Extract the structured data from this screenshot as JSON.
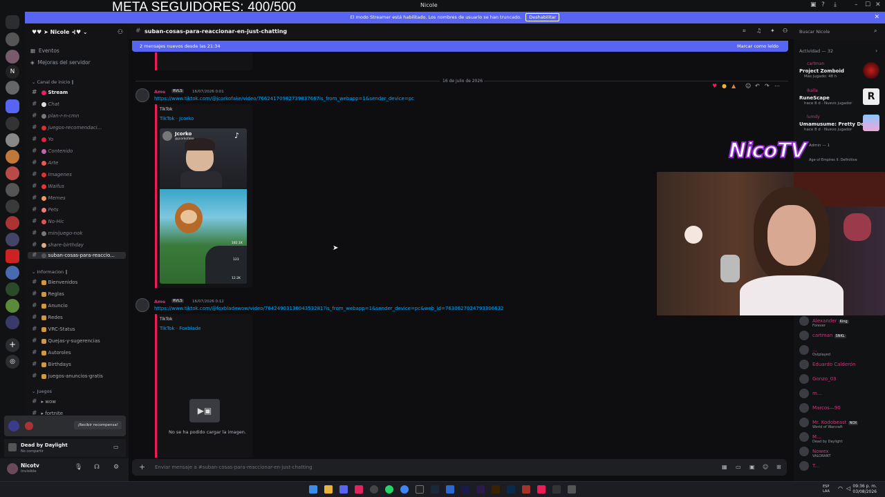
{
  "overlay": {
    "goal": "META SEGUIDORES: 400/500"
  },
  "window": {
    "title": "Nicole",
    "min": "–",
    "max": "☐",
    "close": "✕"
  },
  "banner": {
    "text": "El modo Streamer está habilitado. Los nombres de usuario se han truncado.",
    "button": "Deshabilitar"
  },
  "server": {
    "name": "Nicole",
    "items": [
      {
        "label": "Eventos"
      },
      {
        "label": "Mejoras del servidor"
      }
    ]
  },
  "categories": {
    "canal": "Canal de inicio ‖",
    "info": "Informacion ‖",
    "juegos": "Juegos"
  },
  "channels": [
    {
      "label": "Stream"
    },
    {
      "label": "Chat"
    },
    {
      "label": "plan-r-n-cmn"
    },
    {
      "label": "juegos-recomendaci..."
    },
    {
      "label": "Yo"
    },
    {
      "label": "Contenido"
    },
    {
      "label": "Arte"
    },
    {
      "label": "Imagenes"
    },
    {
      "label": "Waifus"
    },
    {
      "label": "Memes"
    },
    {
      "label": "Pets"
    },
    {
      "label": "No-Hic"
    },
    {
      "label": "minijuego-nok"
    },
    {
      "label": "share-birthday"
    },
    {
      "label": "suban-cosas-para-reaccio..."
    }
  ],
  "info_channels": [
    {
      "label": "Bienvenidos"
    },
    {
      "label": "Reglas"
    },
    {
      "label": "Anuncio"
    },
    {
      "label": "Redes"
    },
    {
      "label": "VRC-Status"
    },
    {
      "label": "Quejas-y-sugerencias"
    },
    {
      "label": "Autoroles"
    },
    {
      "label": "Birthdays"
    },
    {
      "label": "juegos-anuncios-gratis"
    }
  ],
  "game_channels": [
    {
      "label": "wow"
    },
    {
      "label": "fortnite"
    }
  ],
  "promo": {
    "button": "¡Recibir recompensa!"
  },
  "activity_game": {
    "title": "Dead by Daylight",
    "sub": "No compartir"
  },
  "user": {
    "name": "Nicotv",
    "status": "Invisible"
  },
  "header": {
    "channel": "suban-cosas-para-reaccionar-en-just-chatting",
    "search": "Buscar Nicole"
  },
  "newbar": {
    "text": "2 mensajes nuevos desde las 21:34",
    "mark": "Marcar como leído"
  },
  "date_divider": "16 de julio de 2026",
  "messages": [
    {
      "user": "Ame",
      "tag": "RVLS",
      "time": "16/07/2026 0:01",
      "link": "https://www.tiktok.com/@jcorkofake/video/76624170982739837667is_from_webapp=1&sender_device=pc",
      "provider": "TikTok",
      "title": "TikTok · Jcorko",
      "thumb_name": "Jcorko",
      "thumb_handle": "@jcorkofake",
      "likes": "182.1K",
      "comments": "123",
      "shares": "12.2K"
    },
    {
      "user": "Ame",
      "tag": "RVLS",
      "time": "16/07/2026 0:12",
      "link": "https://www.tiktok.com/@foxbladewow/video/7642490313604353281?is_from_webapp=1&sender_device=pc&web_id=7630627024793306632",
      "provider": "TikTok",
      "title": "TikTok · Foxblade",
      "failed": "No se ha podido cargar la imagen."
    }
  ],
  "composer": {
    "placeholder": "Enviar mensaje a #suban-cosas-para-reaccionar-en-just-chatting"
  },
  "activity": {
    "title": "Actividad — 32",
    "items": [
      {
        "user": "cartman",
        "title": "Project Zomboid",
        "sub": "Más jugado: 48 h"
      },
      {
        "user": "Ikalla",
        "title": "RuneScape",
        "sub": "hace 8 d · Nuevo jugador"
      },
      {
        "user": "lumdy",
        "title": "Umamusume: Pretty Derby",
        "sub": "hace 8 d · Nuevo jugador"
      }
    ],
    "admin": "Admin — 1",
    "admin_sub": "Age of Empires II: Definitive"
  },
  "stream_logo": "NicoTV",
  "members": [
    {
      "name": "Alexander",
      "tag": "King",
      "sub": "Forever"
    },
    {
      "name": "cartman",
      "tag": "SNKL",
      "sub": ""
    },
    {
      "name": "...",
      "tag": "",
      "sub": "Outplayed"
    },
    {
      "name": "Eduardo Calderón",
      "tag": "",
      "sub": ""
    },
    {
      "name": "Gonzo_03",
      "tag": "",
      "sub": ""
    },
    {
      "name": "m...",
      "tag": "",
      "sub": ""
    },
    {
      "name": "Marcos—90",
      "tag": "",
      "sub": ""
    },
    {
      "name": "Mr. Kodobeast",
      "tag": "NOX",
      "sub": "World of Warcraft"
    },
    {
      "name": "M...",
      "tag": "",
      "sub": "Dead by Daylight"
    },
    {
      "name": "Nowex",
      "tag": "",
      "sub": "VALORANT"
    },
    {
      "name": "T...",
      "tag": "",
      "sub": ""
    }
  ],
  "clock": {
    "lang": "ESP",
    "region": "LAA",
    "time": "09:36 p. m.",
    "date": "03/08/2026"
  },
  "colors": {
    "accent": "#5865f2",
    "embed": "#ec1d56",
    "role": "#c93a7e",
    "link": "#00a8fc"
  }
}
